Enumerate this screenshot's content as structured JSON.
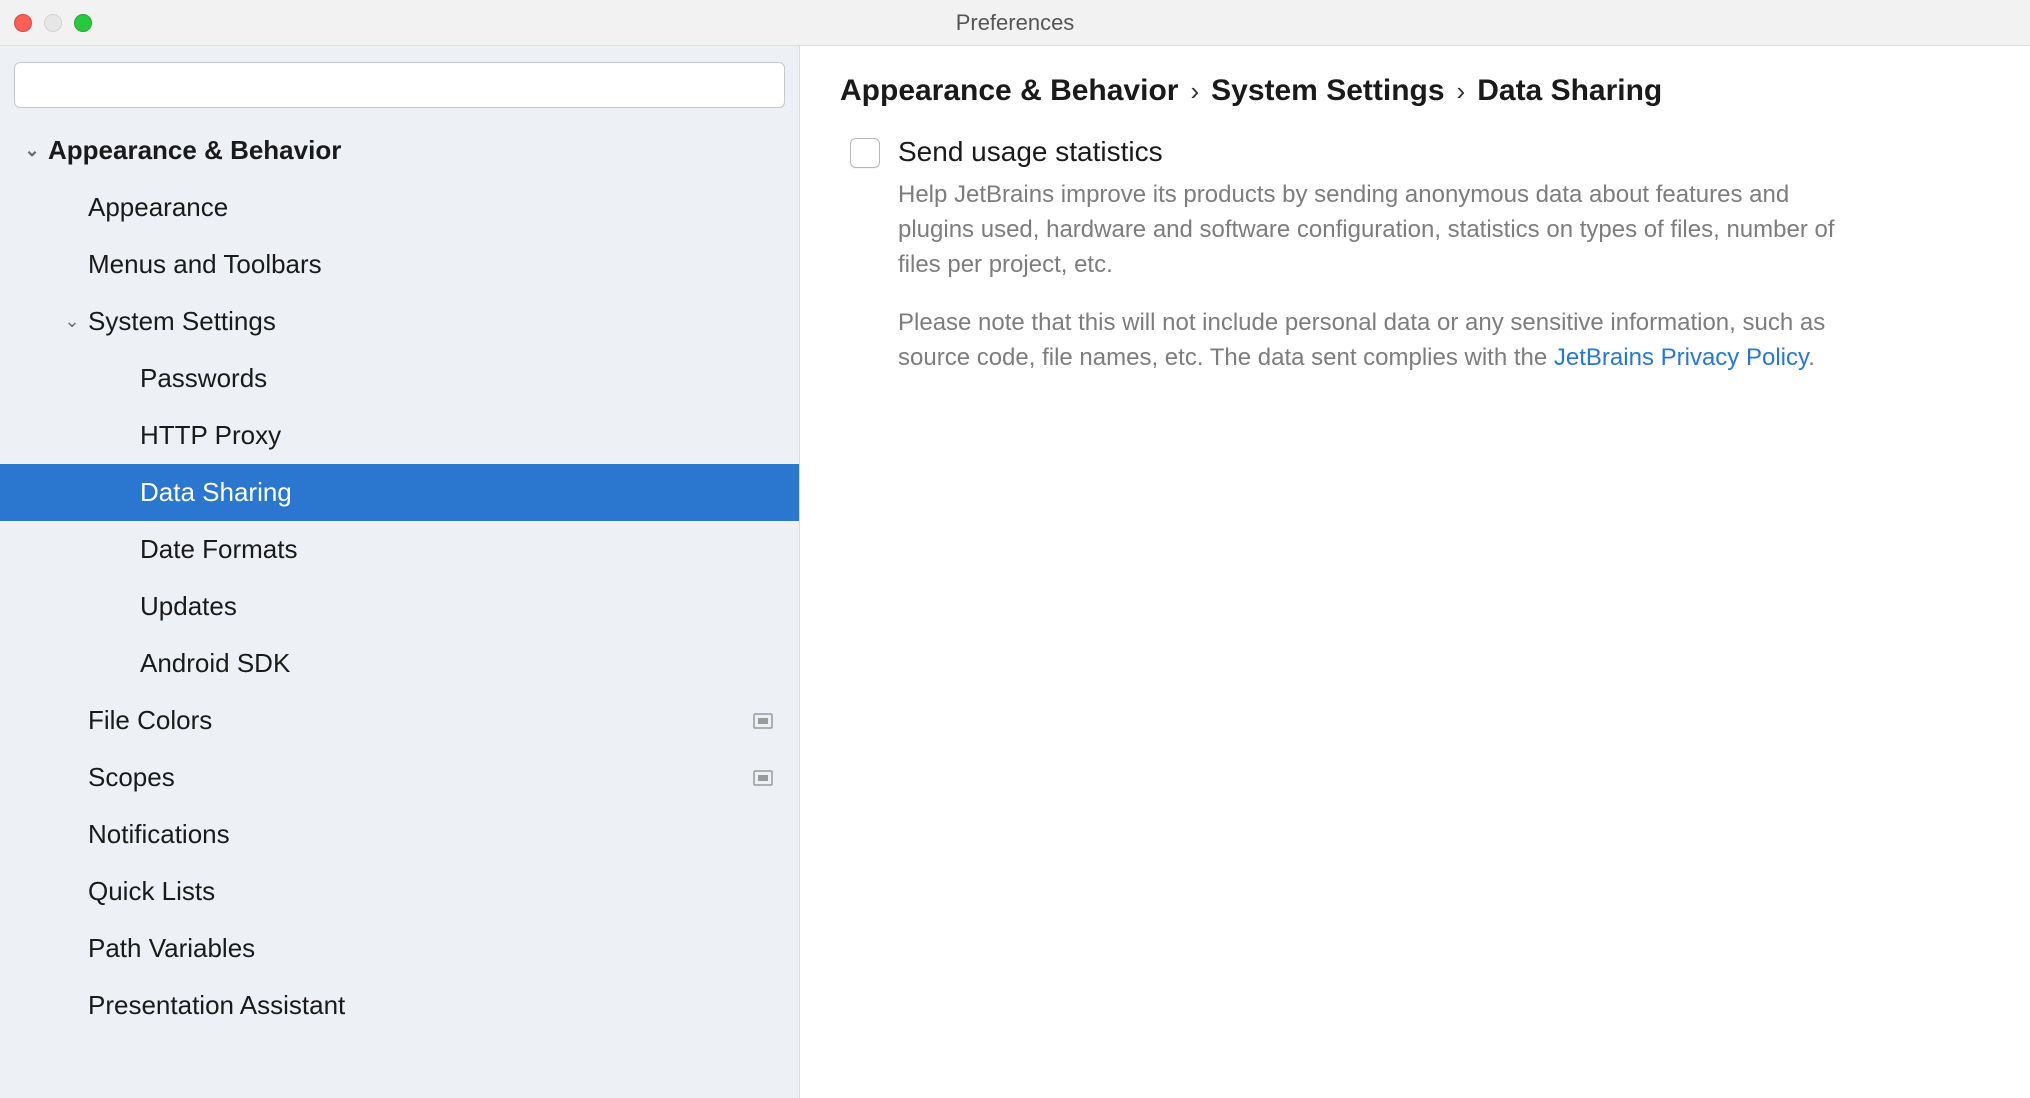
{
  "window": {
    "title": "Preferences"
  },
  "sidebar": {
    "search_placeholder": "",
    "tree": {
      "appearance_behavior": {
        "label": "Appearance & Behavior",
        "children": {
          "appearance": "Appearance",
          "menus_toolbars": "Menus and Toolbars",
          "system_settings": {
            "label": "System Settings",
            "children": {
              "passwords": "Passwords",
              "http_proxy": "HTTP Proxy",
              "data_sharing": "Data Sharing",
              "date_formats": "Date Formats",
              "updates": "Updates",
              "android_sdk": "Android SDK"
            }
          },
          "file_colors": "File Colors",
          "scopes": "Scopes",
          "notifications": "Notifications",
          "quick_lists": "Quick Lists",
          "path_variables": "Path Variables",
          "presentation_assistant": "Presentation Assistant"
        }
      }
    }
  },
  "breadcrumb": {
    "a": "Appearance & Behavior",
    "b": "System Settings",
    "c": "Data Sharing"
  },
  "content": {
    "checkbox_label": "Send usage statistics",
    "desc1": "Help JetBrains improve its products by sending anonymous data about features and plugins used, hardware and software configuration, statistics on types of files, number of files per project, etc.",
    "desc2_pre": "Please note that this will not include personal data or any sensitive information, such as source code, file names, etc. The data sent complies with the ",
    "desc2_link": "JetBrains Privacy Policy",
    "desc2_post": "."
  }
}
